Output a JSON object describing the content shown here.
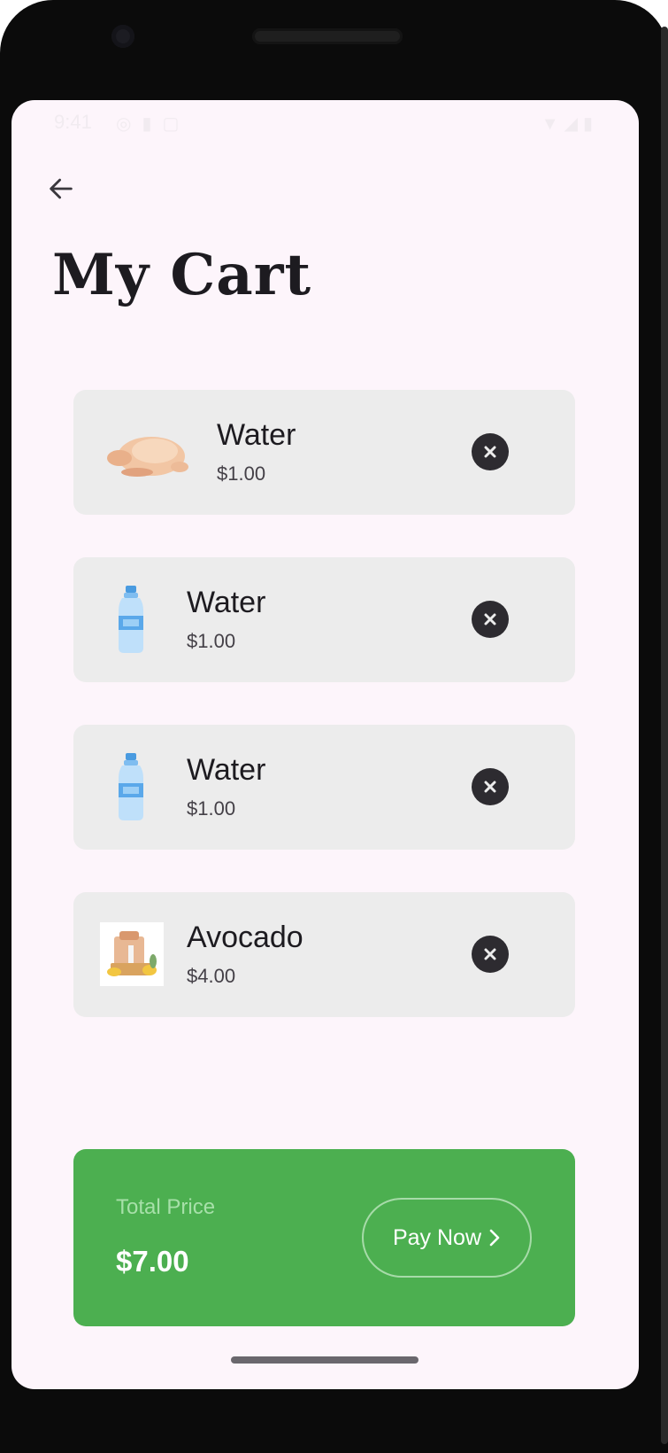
{
  "status_bar": {
    "time": "9:41",
    "left_icons": [
      "location-icon",
      "sd-card-icon",
      "screenshot-icon"
    ],
    "right_icons": [
      "wifi-icon",
      "signal-icon",
      "battery-icon"
    ]
  },
  "header": {
    "back_icon": "arrow-left-icon",
    "title": "My Cart"
  },
  "cart": {
    "items": [
      {
        "name": "Water",
        "price": "$1.00",
        "image": "chicken"
      },
      {
        "name": "Water",
        "price": "$1.00",
        "image": "water-bottle"
      },
      {
        "name": "Water",
        "price": "$1.00",
        "image": "water-bottle"
      },
      {
        "name": "Avocado",
        "price": "$4.00",
        "image": "grocery-bag"
      }
    ],
    "remove_icon": "close-circle-icon"
  },
  "total": {
    "label": "Total Price",
    "value": "$7.00",
    "pay_label": "Pay Now",
    "pay_icon": "chevron-right-icon"
  },
  "colors": {
    "screen_bg": "#fdf5fb",
    "item_bg": "#ececec",
    "accent_green": "#4caf50",
    "text_dark": "#1d1b20"
  }
}
